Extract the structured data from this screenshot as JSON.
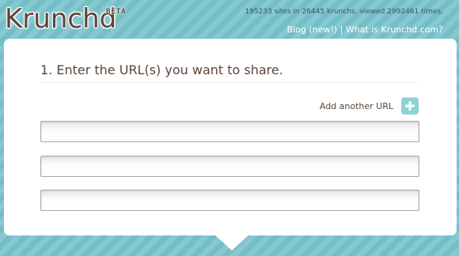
{
  "header": {
    "logo_text": "Krunchd",
    "beta_label": "BETA",
    "stats": "195233 sites in 26445 krunchs, viewed 2992461 times.",
    "links": [
      {
        "label": "Blog (new!)"
      },
      {
        "label": "What is Krunchd.com?"
      }
    ],
    "link_separator": "|"
  },
  "main": {
    "step_title": "1. Enter the URL(s) you want to share.",
    "add_url_label": "Add another URL",
    "url_inputs": [
      {
        "value": "",
        "placeholder": ""
      },
      {
        "value": "",
        "placeholder": ""
      },
      {
        "value": "",
        "placeholder": ""
      }
    ]
  },
  "colors": {
    "background": "#7cc3cc",
    "brand_brown": "#5b4538",
    "accent_teal": "#8fd0d8",
    "panel": "#ffffff"
  }
}
